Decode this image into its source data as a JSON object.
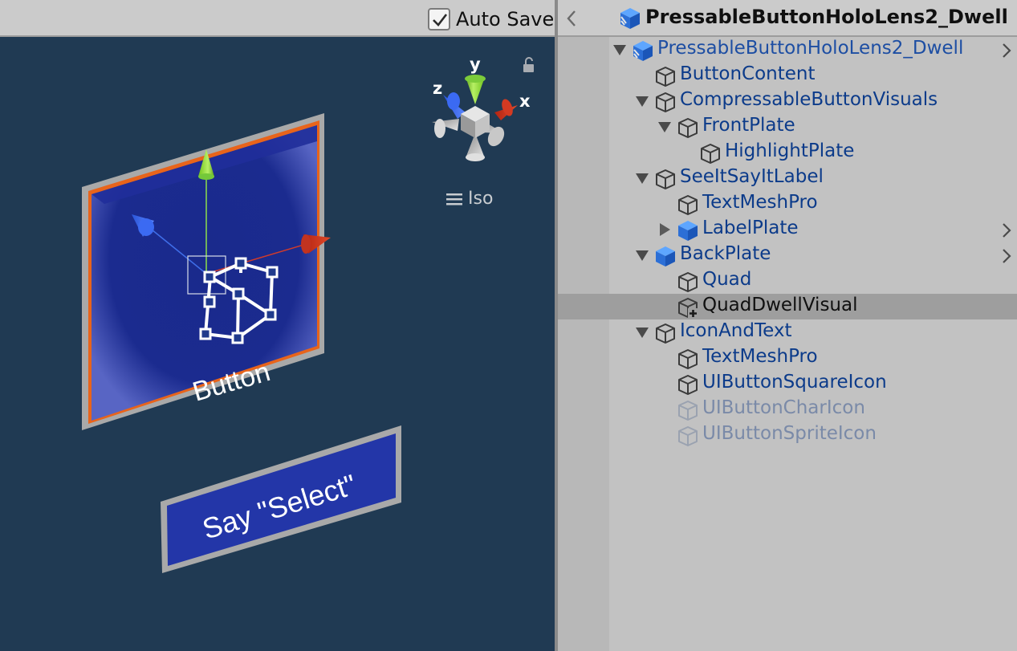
{
  "scene": {
    "toolbar": {
      "autosave_label": "Auto Save",
      "autosave_checked": true
    },
    "gizmo": {
      "axis_x": "x",
      "axis_y": "y",
      "axis_z": "z",
      "projection_label": "Iso"
    },
    "button_label": "Button",
    "speech_label": "Say \"Select\"",
    "colors": {
      "background": "#203a53",
      "plate": "#1c2a8c",
      "outline": "#e8641b"
    }
  },
  "hierarchy": {
    "title": "PressableButtonHoloLens2_Dwell",
    "items": [
      {
        "label": "PressableButtonHoloLens2_Dwell",
        "depth": 0,
        "expanded": true,
        "icon": "prefab-root-icon",
        "has_more": true
      },
      {
        "label": "ButtonContent",
        "depth": 1,
        "icon": "gameobject-icon"
      },
      {
        "label": "CompressableButtonVisuals",
        "depth": 1,
        "expanded": true,
        "icon": "gameobject-icon"
      },
      {
        "label": "FrontPlate",
        "depth": 2,
        "expanded": true,
        "icon": "gameobject-icon"
      },
      {
        "label": "HighlightPlate",
        "depth": 3,
        "icon": "gameobject-icon"
      },
      {
        "label": "SeeItSayItLabel",
        "depth": 1,
        "expanded": true,
        "icon": "gameobject-icon"
      },
      {
        "label": "TextMeshPro",
        "depth": 2,
        "icon": "gameobject-icon"
      },
      {
        "label": "LabelPlate",
        "depth": 2,
        "expanded": false,
        "icon": "prefab-icon",
        "has_more": true
      },
      {
        "label": "BackPlate",
        "depth": 1,
        "expanded": true,
        "icon": "prefab-icon",
        "has_more": true
      },
      {
        "label": "Quad",
        "depth": 2,
        "icon": "gameobject-icon"
      },
      {
        "label": "QuadDwellVisual",
        "depth": 2,
        "icon": "gameobject-added-icon",
        "selected": true
      },
      {
        "label": "IconAndText",
        "depth": 1,
        "expanded": true,
        "icon": "gameobject-icon"
      },
      {
        "label": "TextMeshPro",
        "depth": 2,
        "icon": "gameobject-icon"
      },
      {
        "label": "UIButtonSquareIcon",
        "depth": 2,
        "icon": "gameobject-icon"
      },
      {
        "label": "UIButtonCharIcon",
        "depth": 2,
        "icon": "gameobject-icon",
        "disabled": true
      },
      {
        "label": "UIButtonSpriteIcon",
        "depth": 2,
        "icon": "gameobject-icon",
        "disabled": true
      }
    ]
  }
}
